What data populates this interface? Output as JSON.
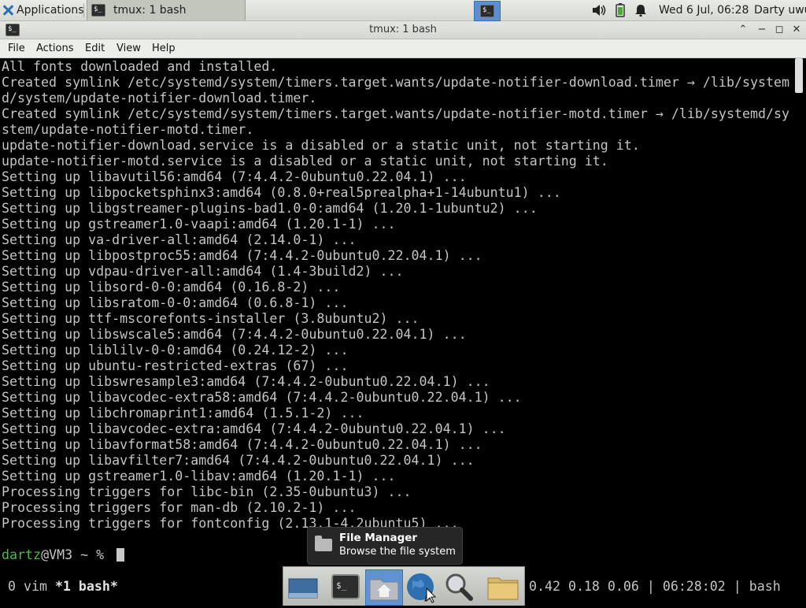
{
  "panel": {
    "applications_label": "Applications",
    "task_label": "tmux: 1 bash",
    "clock": "Wed  6 Jul, 06:28",
    "user": "Darty uwu"
  },
  "window": {
    "title": "tmux: 1 bash",
    "menu": [
      "File",
      "Actions",
      "Edit",
      "View",
      "Help"
    ]
  },
  "terminal": {
    "lines": [
      "All fonts downloaded and installed.",
      "Created symlink /etc/systemd/system/timers.target.wants/update-notifier-download.timer → /lib/system",
      "d/system/update-notifier-download.timer.",
      "Created symlink /etc/systemd/system/timers.target.wants/update-notifier-motd.timer → /lib/systemd/sy",
      "stem/update-notifier-motd.timer.",
      "update-notifier-download.service is a disabled or a static unit, not starting it.",
      "update-notifier-motd.service is a disabled or a static unit, not starting it.",
      "Setting up libavutil56:amd64 (7:4.4.2-0ubuntu0.22.04.1) ...",
      "Setting up libpocketsphinx3:amd64 (0.8.0+real5prealpha+1-14ubuntu1) ...",
      "Setting up libgstreamer-plugins-bad1.0-0:amd64 (1.20.1-1ubuntu2) ...",
      "Setting up gstreamer1.0-vaapi:amd64 (1.20.1-1) ...",
      "Setting up va-driver-all:amd64 (2.14.0-1) ...",
      "Setting up libpostproc55:amd64 (7:4.4.2-0ubuntu0.22.04.1) ...",
      "Setting up vdpau-driver-all:amd64 (1.4-3build2) ...",
      "Setting up libsord-0-0:amd64 (0.16.8-2) ...",
      "Setting up libsratom-0-0:amd64 (0.6.8-1) ...",
      "Setting up ttf-mscorefonts-installer (3.8ubuntu2) ...",
      "Setting up libswscale5:amd64 (7:4.4.2-0ubuntu0.22.04.1) ...",
      "Setting up liblilv-0-0:amd64 (0.24.12-2) ...",
      "Setting up ubuntu-restricted-extras (67) ...",
      "Setting up libswresample3:amd64 (7:4.4.2-0ubuntu0.22.04.1) ...",
      "Setting up libavcodec-extra58:amd64 (7:4.4.2-0ubuntu0.22.04.1) ...",
      "Setting up libchromaprint1:amd64 (1.5.1-2) ...",
      "Setting up libavcodec-extra:amd64 (7:4.4.2-0ubuntu0.22.04.1) ...",
      "Setting up libavformat58:amd64 (7:4.4.2-0ubuntu0.22.04.1) ...",
      "Setting up libavfilter7:amd64 (7:4.4.2-0ubuntu0.22.04.1) ...",
      "Setting up gstreamer1.0-libav:amd64 (1.20.1-1) ...",
      "Processing triggers for libc-bin (2.35-0ubuntu3) ...",
      "Processing triggers for man-db (2.10.2-1) ...",
      "Processing triggers for fontconfig (2.13.1-4.2ubuntu5) ..."
    ],
    "prompt_user": "dartz",
    "prompt_rest": "@VM3 ~ % "
  },
  "tmux_status": {
    "windows": " 0 vim ",
    "active_window": "*1 bash*",
    "right": "0.42 0.18 0.06 | 06:28:02 | bash"
  },
  "tooltip": {
    "title": "File Manager",
    "subtitle": "Browse the file system"
  },
  "dock": {
    "items": [
      "show-desktop-icon",
      "terminal-icon",
      "home-folder-icon",
      "web-browser-icon",
      "search-icon",
      "folder-icon"
    ]
  }
}
